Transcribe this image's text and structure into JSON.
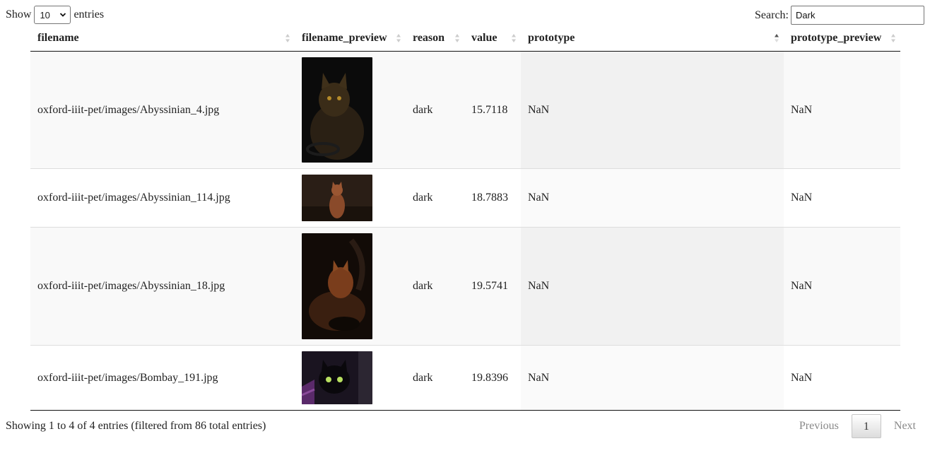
{
  "controls": {
    "show_label": "Show",
    "entries_label": "entries",
    "page_length": "10",
    "search_label": "Search:",
    "search_value": "Dark"
  },
  "table": {
    "headers": [
      "filename",
      "filename_preview",
      "reason",
      "value",
      "prototype",
      "prototype_preview"
    ],
    "rows": [
      {
        "filename": "oxford-iiit-pet/images/Abyssinian_4.jpg",
        "preview": "dark cat photo",
        "reason": "dark",
        "value": "15.7118",
        "prototype": "NaN",
        "prototype_preview": "NaN"
      },
      {
        "filename": "oxford-iiit-pet/images/Abyssinian_114.jpg",
        "preview": "dark cat photo",
        "reason": "dark",
        "value": "18.7883",
        "prototype": "NaN",
        "prototype_preview": "NaN"
      },
      {
        "filename": "oxford-iiit-pet/images/Abyssinian_18.jpg",
        "preview": "dark cat photo",
        "reason": "dark",
        "value": "19.5741",
        "prototype": "NaN",
        "prototype_preview": "NaN"
      },
      {
        "filename": "oxford-iiit-pet/images/Bombay_191.jpg",
        "preview": "dark cat photo",
        "reason": "dark",
        "value": "19.8396",
        "prototype": "NaN",
        "prototype_preview": "NaN"
      }
    ]
  },
  "footer": {
    "info": "Showing 1 to 4 of 4 entries (filtered from 86 total entries)",
    "previous": "Previous",
    "current_page": "1",
    "next": "Next"
  },
  "colors": {
    "row_odd": "#f9f9f9",
    "sorted_col_odd": "#f1f1f1",
    "header_border": "#111111",
    "disabled_link": "#888888"
  }
}
